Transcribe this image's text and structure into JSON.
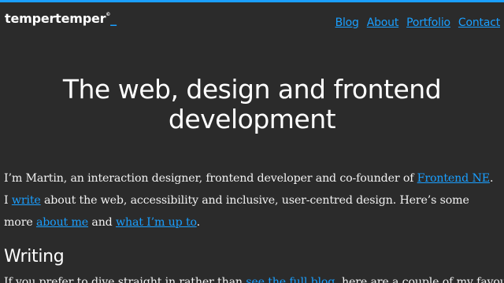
{
  "brand": {
    "name": "tempertemper",
    "mark": "©",
    "cursor": "_",
    "accent_color": "#1a9fff",
    "background_color": "#2b2b2b"
  },
  "nav": {
    "items": [
      {
        "label": "Blog"
      },
      {
        "label": "About"
      },
      {
        "label": "Portfolio"
      },
      {
        "label": "Contact"
      }
    ]
  },
  "hero": {
    "title": "The web, design and frontend development"
  },
  "intro": {
    "text_1": "I’m Martin, an interaction designer, frontend developer and co-founder of ",
    "link_1": "Frontend NE",
    "text_2": ". I ",
    "link_2": "write",
    "text_3": " about the web, accessibility and inclusive, user-centred design. Here’s some more ",
    "link_3": "about me",
    "text_4": " and ",
    "link_4": "what I’m up to",
    "text_5": "."
  },
  "writing": {
    "heading": "Writing",
    "text_1": "If you prefer to dive straight in rather than ",
    "link_1": "see the full blog",
    "text_2": ", here are a couple of my favourite"
  }
}
